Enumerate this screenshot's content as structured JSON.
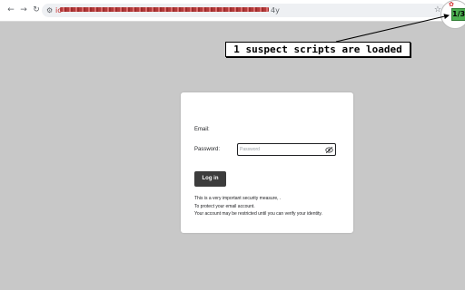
{
  "browser": {
    "back_icon": "arrow-left-icon",
    "forward_icon": "arrow-right-icon",
    "reload_icon": "reload-icon",
    "url_prefix": "ic",
    "url_suffix": "4y",
    "bookmark_icon": "star-icon"
  },
  "extension": {
    "counter": "1/3",
    "bug_icon": "bug-icon",
    "color": "#4caf50"
  },
  "callout": {
    "text": "1 suspect scripts are loaded"
  },
  "login": {
    "email_label": "Email:",
    "password_label": "Password:",
    "password_placeholder": "Password",
    "password_value": "",
    "visibility_icon": "eye-off-icon",
    "button_label": "Log in",
    "info_lines": [
      "This is a very important security measure, .",
      "To protect your email account.",
      "Your account may be restricted until you can verify your identity."
    ]
  }
}
